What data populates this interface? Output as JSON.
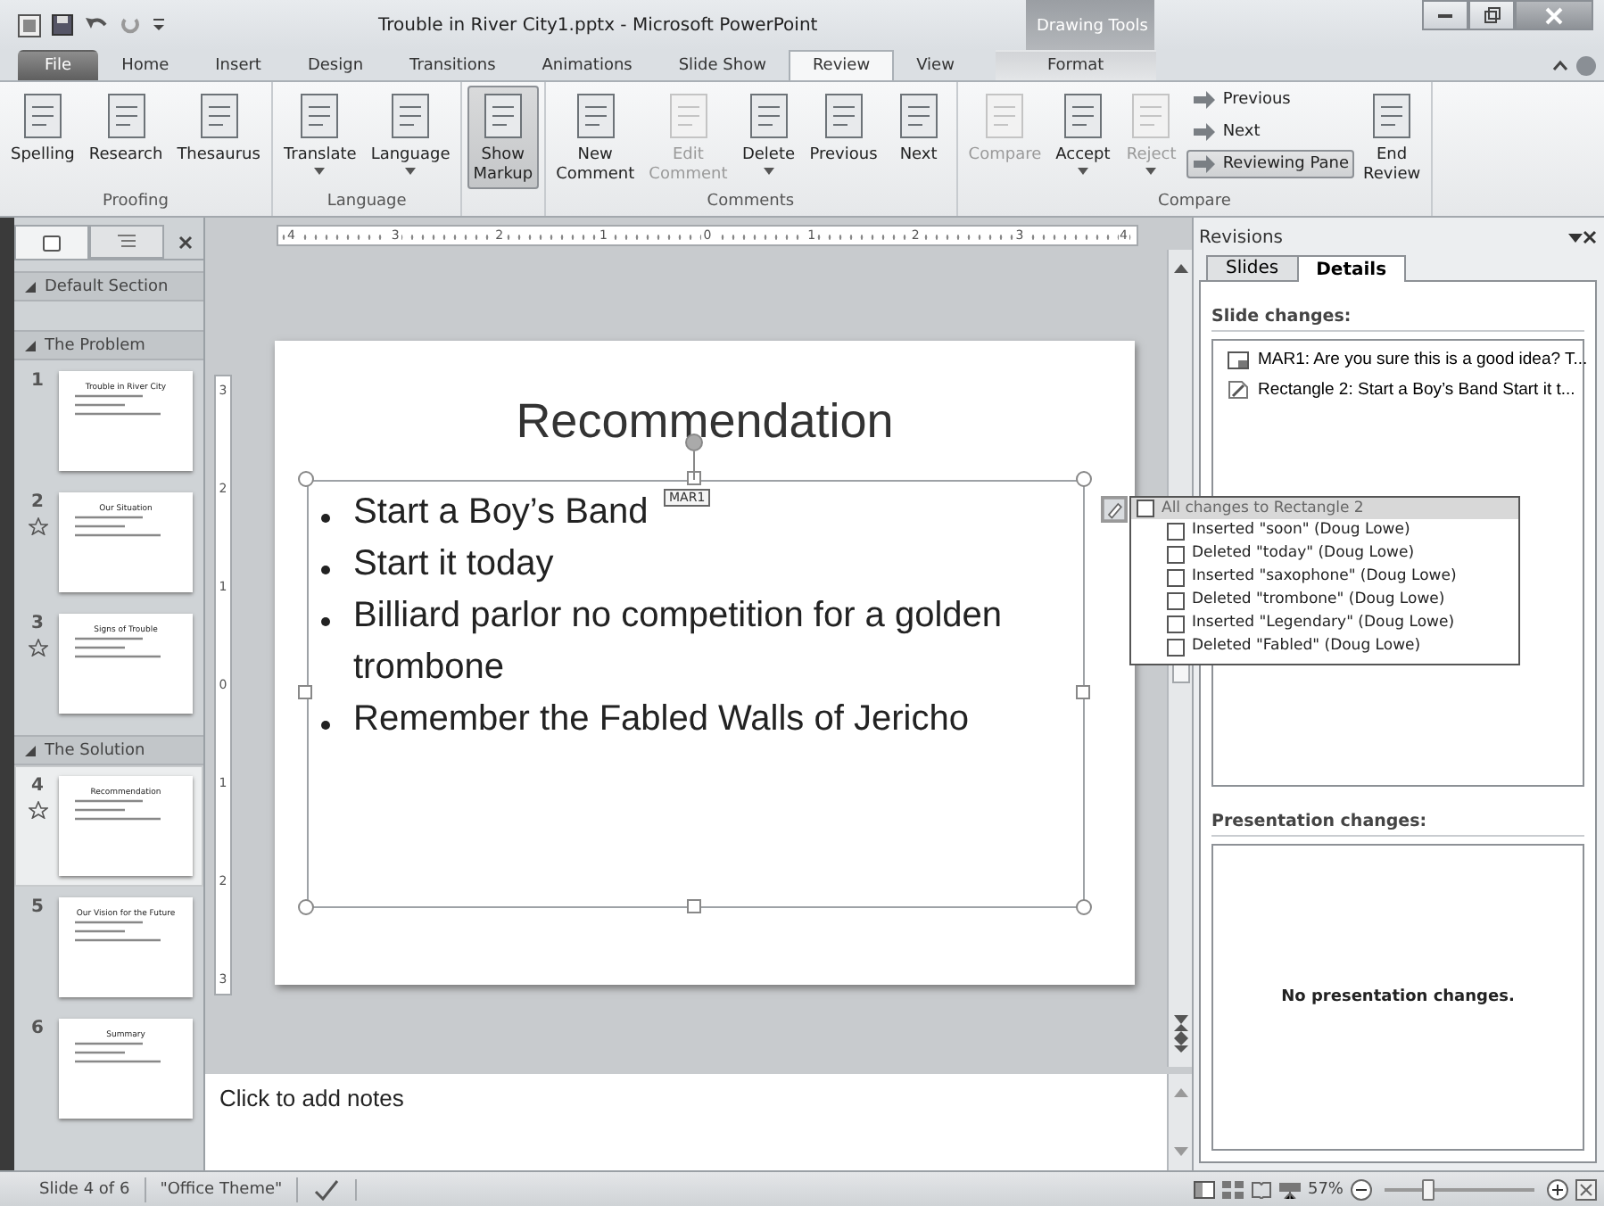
{
  "window": {
    "title": "Trouble in River City1.pptx - Microsoft PowerPoint",
    "context_label": "Drawing Tools"
  },
  "tabs": [
    {
      "label": "File",
      "kind": "file",
      "selected": false
    },
    {
      "label": "Home",
      "kind": "tab",
      "selected": false
    },
    {
      "label": "Insert",
      "kind": "tab",
      "selected": false
    },
    {
      "label": "Design",
      "kind": "tab",
      "selected": false
    },
    {
      "label": "Transitions",
      "kind": "tab",
      "selected": false
    },
    {
      "label": "Animations",
      "kind": "tab",
      "selected": false
    },
    {
      "label": "Slide Show",
      "kind": "tab",
      "selected": false
    },
    {
      "label": "Review",
      "kind": "tab",
      "selected": true
    },
    {
      "label": "View",
      "kind": "tab",
      "selected": false
    },
    {
      "label": "Format",
      "kind": "context",
      "selected": false
    }
  ],
  "ribbon": {
    "groups": [
      {
        "label": "Proofing",
        "buttons": [
          {
            "label": "Spelling",
            "kind": "large",
            "disabled": false,
            "selected": false,
            "dropdown": false
          },
          {
            "label": "Research",
            "kind": "large",
            "disabled": false,
            "selected": false,
            "dropdown": false
          },
          {
            "label": "Thesaurus",
            "kind": "large",
            "disabled": false,
            "selected": false,
            "dropdown": false
          }
        ]
      },
      {
        "label": "Language",
        "buttons": [
          {
            "label": "Translate",
            "kind": "large",
            "disabled": false,
            "selected": false,
            "dropdown": true
          },
          {
            "label": "Language",
            "kind": "large",
            "disabled": false,
            "selected": false,
            "dropdown": true
          }
        ]
      },
      {
        "buttons": [
          {
            "label": "Show Markup",
            "kind": "large",
            "disabled": false,
            "selected": true,
            "dropdown": false
          }
        ]
      },
      {
        "label": "Comments",
        "buttons": [
          {
            "label": "New Comment",
            "kind": "large",
            "disabled": false,
            "selected": false,
            "dropdown": false
          },
          {
            "label": "Edit Comment",
            "kind": "large",
            "disabled": true,
            "selected": false,
            "dropdown": false
          },
          {
            "label": "Delete",
            "kind": "large",
            "disabled": false,
            "selected": false,
            "dropdown": true
          },
          {
            "label": "Previous",
            "kind": "large",
            "disabled": false,
            "selected": false,
            "dropdown": false
          },
          {
            "label": "Next",
            "kind": "large",
            "disabled": false,
            "selected": false,
            "dropdown": false
          }
        ]
      },
      {
        "label": "Compare",
        "buttons": [
          {
            "label": "Compare",
            "kind": "large",
            "disabled": true,
            "selected": false,
            "dropdown": false
          },
          {
            "label": "Accept",
            "kind": "large",
            "disabled": false,
            "selected": false,
            "dropdown": true
          },
          {
            "label": "Reject",
            "kind": "large",
            "disabled": true,
            "selected": false,
            "dropdown": true
          },
          {
            "label": "Previous",
            "kind": "small",
            "disabled": false,
            "selected": false,
            "dropdown": false
          },
          {
            "label": "Next",
            "kind": "small",
            "disabled": false,
            "selected": false,
            "dropdown": false
          },
          {
            "label": "Reviewing Pane",
            "kind": "small",
            "disabled": false,
            "selected": true,
            "dropdown": false
          },
          {
            "label": "End Review",
            "kind": "large",
            "disabled": false,
            "selected": false,
            "dropdown": false
          }
        ]
      }
    ]
  },
  "slides_panel": {
    "sections": [
      {
        "label": "Default Section",
        "expanded": true
      },
      {
        "label": "The Problem",
        "expanded": true,
        "slides": [
          {
            "number": "1",
            "title": "Trouble in River City",
            "marked": false,
            "selected": false
          },
          {
            "number": "2",
            "title": "Our Situation",
            "marked": true,
            "selected": false
          },
          {
            "number": "3",
            "title": "Signs of Trouble",
            "marked": true,
            "selected": false
          }
        ]
      },
      {
        "label": "The Solution",
        "expanded": true,
        "slides": [
          {
            "number": "4",
            "title": "Recommendation",
            "marked": true,
            "selected": true
          },
          {
            "number": "5",
            "title": "Our Vision for the Future",
            "marked": false,
            "selected": false
          },
          {
            "number": "6",
            "title": "Summary",
            "marked": false,
            "selected": false
          }
        ]
      }
    ]
  },
  "ruler": {
    "horizontal": [
      "4",
      "3",
      "2",
      "1",
      "0",
      "1",
      "2",
      "3",
      "4"
    ],
    "vertical": [
      "3",
      "2",
      "1",
      "0",
      "1",
      "2",
      "3"
    ]
  },
  "slide": {
    "title": "Recommendation",
    "bullets": [
      "Start a Boy’s Band",
      "Start it today",
      "Billiard parlor no competition for a golden trombone",
      "Remember the Fabled Walls of Jericho"
    ],
    "comment_marker": "MAR1"
  },
  "changes_popup": {
    "header": {
      "label": "All changes to Rectangle 2",
      "checked": false
    },
    "items": [
      {
        "label": "Inserted \"soon\" (Doug Lowe)",
        "checked": false
      },
      {
        "label": "Deleted \"today\" (Doug Lowe)",
        "checked": false
      },
      {
        "label": "Inserted \"saxophone\" (Doug Lowe)",
        "checked": false
      },
      {
        "label": "Deleted \"trombone\" (Doug Lowe)",
        "checked": false
      },
      {
        "label": "Inserted \"Legendary\" (Doug Lowe)",
        "checked": false
      },
      {
        "label": "Deleted \"Fabled\" (Doug Lowe)",
        "checked": false
      }
    ]
  },
  "notes": {
    "placeholder": "Click to add notes"
  },
  "revisions_pane": {
    "title": "Revisions",
    "tabs": [
      {
        "label": "Slides",
        "selected": false
      },
      {
        "label": "Details",
        "selected": true
      }
    ],
    "slide_changes_heading": "Slide changes:",
    "slide_changes": [
      {
        "kind": "comment",
        "text": "MAR1: Are you sure this is a good idea? T..."
      },
      {
        "kind": "shape",
        "text": "Rectangle 2: Start a Boy’s Band Start it t..."
      }
    ],
    "presentation_changes_heading": "Presentation changes:",
    "presentation_changes_message": "No presentation changes."
  },
  "status_bar": {
    "slide_info": "Slide 4 of 6",
    "theme": "\"Office Theme\"",
    "zoom": "57%",
    "zoom_slider": {
      "level": 0.28
    }
  }
}
